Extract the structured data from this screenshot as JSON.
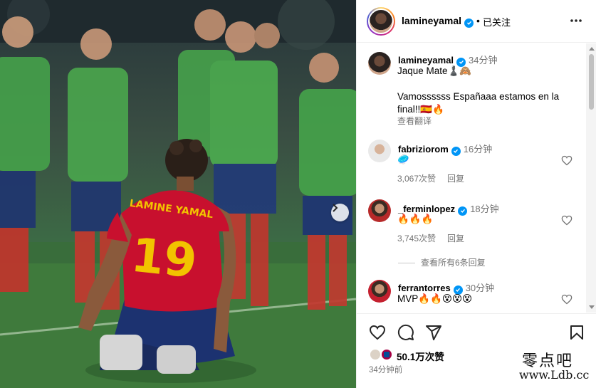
{
  "post": {
    "username": "lamineyamal",
    "separator": "•",
    "follow_status": "已关注",
    "caption": {
      "time": "34分钟",
      "line1": "Jaque Mate♟️🙈",
      "line2": "Vamossssss Españaaa estamos en la final!!🇪🇸🔥",
      "translate": "查看翻译"
    }
  },
  "photo": {
    "jersey_name": "LAMINE YAMAL",
    "jersey_number": "19"
  },
  "comments": [
    {
      "username": "fabriziorom",
      "time": "16分钟",
      "text": "🥏",
      "likes": "3,067次赞",
      "reply": "回复"
    },
    {
      "username": "_ferminlopez",
      "time": "18分钟",
      "text": "🔥🔥🔥",
      "likes": "3,745次赞",
      "reply": "回复"
    },
    {
      "username": "ferrantorres",
      "time": "30分钟",
      "text": "MVP🔥🔥😵😵😵"
    }
  ],
  "view_replies": "查看所有6条回复",
  "footer": {
    "likes": "50.1万次赞",
    "posted": "34分钟前"
  },
  "watermark": {
    "top": "零点吧",
    "bottom": "www.Ldb.cc"
  },
  "icons": {
    "more": "more-horizontal-icon",
    "verified": "verified-badge-icon",
    "heart": "heart-icon",
    "comment": "comment-icon",
    "share": "share-icon",
    "save": "bookmark-icon",
    "next": "chevron-right-icon"
  },
  "colors": {
    "verified": "#0095f6",
    "muted": "#737373",
    "jersey_red": "#c8102e",
    "jersey_gold": "#f2c300"
  }
}
